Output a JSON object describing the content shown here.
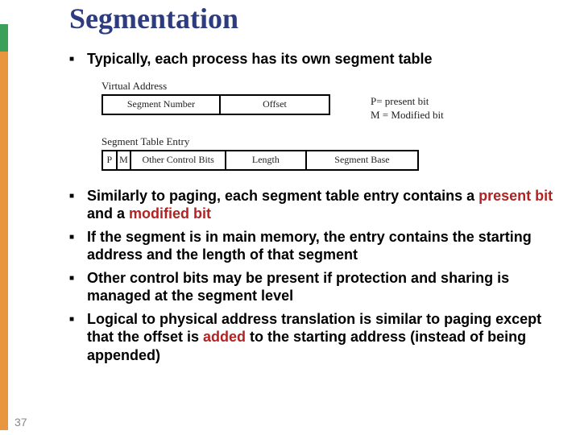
{
  "slide_number": "37",
  "title": "Segmentation",
  "top_bullet": "Typically, each process has its own segment table",
  "diagram": {
    "virtual_label": "Virtual Address",
    "seg_num": "Segment Number",
    "offset": "Offset",
    "legend_p": "P= present bit",
    "legend_m": "M = Modified bit",
    "entry_label": "Segment Table Entry",
    "p": "P",
    "m": "M",
    "ctrl": "Other Control Bits",
    "length": "Length",
    "base": "Segment Base"
  },
  "bullets": {
    "b1_a": "Similarly to paging, each segment table entry contains a ",
    "b1_k1": "present bit",
    "b1_b": " and a ",
    "b1_k2": "modified bit",
    "b2": "If the segment is in main memory, the entry contains the starting address and the length of that segment",
    "b3": "Other control bits may be present if protection and sharing is managed at the segment level",
    "b4_a": "Logical to physical address translation is similar to paging except that the offset is ",
    "b4_k": "added",
    "b4_b": " to the starting address (instead of being appended)"
  }
}
